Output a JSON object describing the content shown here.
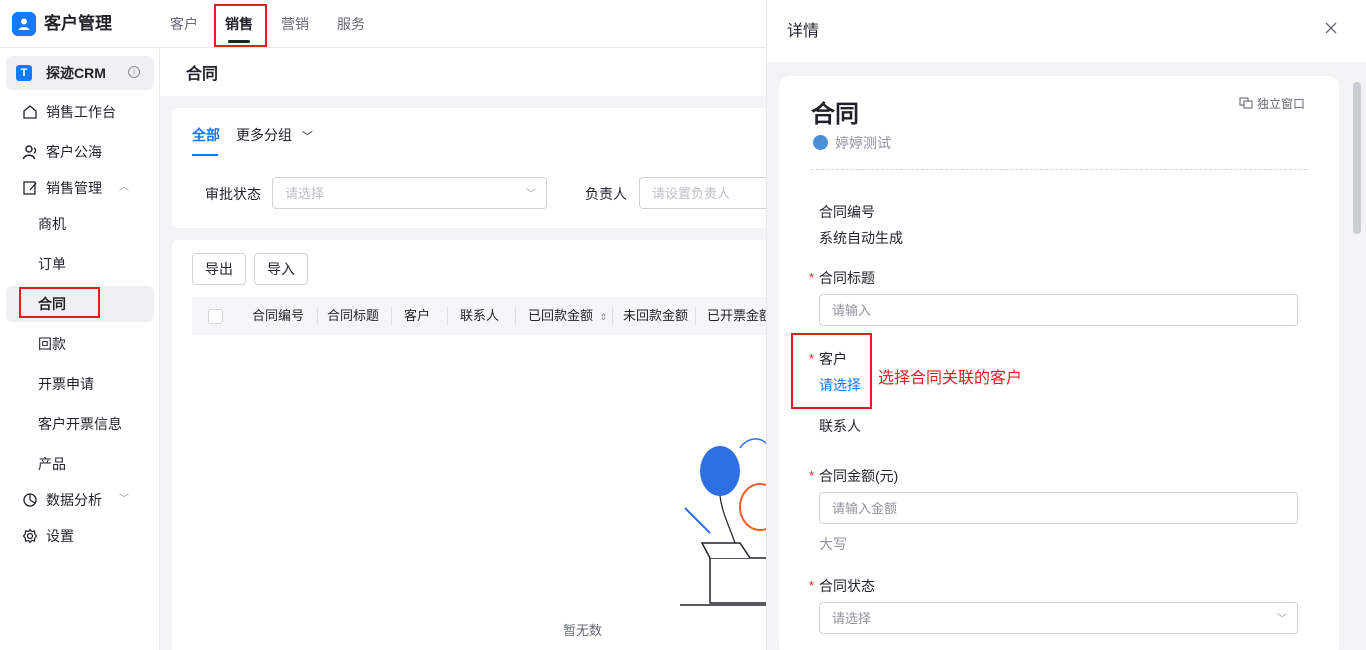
{
  "app": {
    "title": "客户管理"
  },
  "top_tabs": [
    {
      "label": "客户"
    },
    {
      "label": "销售"
    },
    {
      "label": "营销"
    },
    {
      "label": "服务"
    }
  ],
  "sidebar": {
    "workspace": "探迹CRM",
    "items": [
      {
        "label": "销售工作台",
        "icon": "home-icon"
      },
      {
        "label": "客户公海",
        "icon": "user-icon"
      },
      {
        "label": "销售管理",
        "icon": "edit-icon"
      },
      {
        "label": "数据分析",
        "icon": "chart-icon"
      },
      {
        "label": "设置",
        "icon": "gear-icon"
      }
    ],
    "sub_items": [
      {
        "label": "商机"
      },
      {
        "label": "订单"
      },
      {
        "label": "合同"
      },
      {
        "label": "回款"
      },
      {
        "label": "开票申请"
      },
      {
        "label": "客户开票信息"
      },
      {
        "label": "产品"
      }
    ]
  },
  "main": {
    "page_title": "合同",
    "filter_tabs": [
      {
        "label": "全部"
      },
      {
        "label": "更多分组"
      }
    ],
    "filters": {
      "approval_label": "审批状态",
      "approval_placeholder": "请选择",
      "owner_label": "负责人",
      "owner_placeholder": "请设置负责人"
    },
    "buttons": {
      "export": "导出",
      "import": "导入"
    },
    "columns": [
      "合同编号",
      "合同标题",
      "客户",
      "联系人",
      "已回款金额",
      "未回款金额",
      "已开票金额"
    ],
    "empty_text": "暂无数"
  },
  "drawer": {
    "title": "详情",
    "record_type": "合同",
    "owner": "婷婷测试",
    "popout_label": "独立窗口",
    "fields": {
      "contract_no_label": "合同编号",
      "contract_no_value": "系统自动生成",
      "title_label": "合同标题",
      "title_placeholder": "请输入",
      "customer_label": "客户",
      "customer_value": "请选择",
      "contact_label": "联系人",
      "amount_label": "合同金额(元)",
      "amount_placeholder": "请输入金额",
      "amount_upper_label": "大写",
      "status_label": "合同状态",
      "status_placeholder": "请选择"
    },
    "annotation": "选择合同关联的客户"
  },
  "colors": {
    "accent": "#1677ff",
    "annotation": "#e02020"
  }
}
